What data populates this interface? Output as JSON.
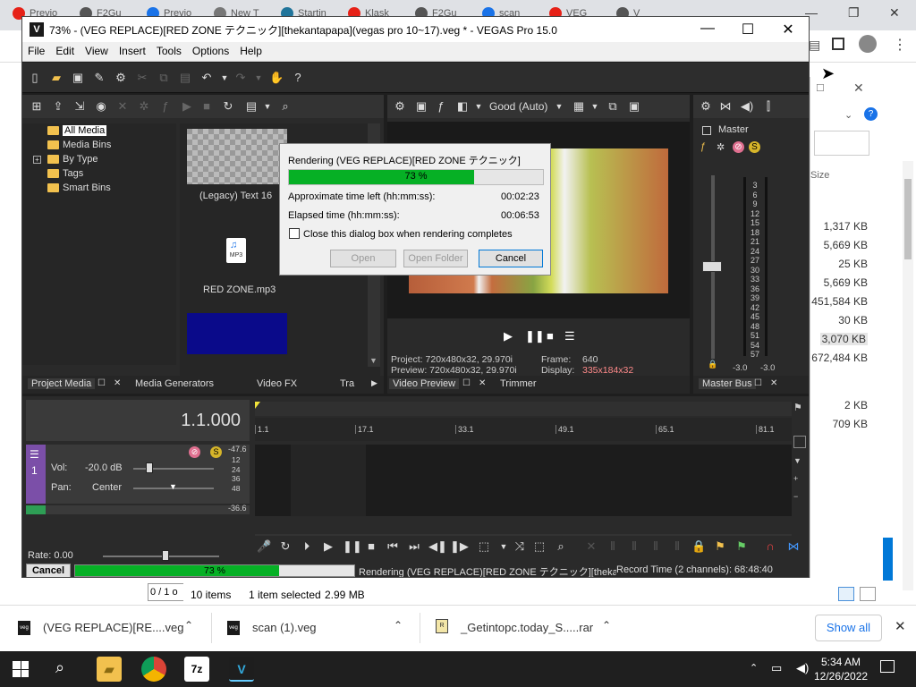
{
  "browser": {
    "tabs": [
      "Previo",
      "F2Gu",
      "Previo",
      "New T",
      "Startin",
      "Klask",
      "F2Gu",
      "scan",
      "VEG",
      "V"
    ],
    "tab_colors": [
      "#e62117",
      "#555555",
      "#1a73e8",
      "#777777",
      "#21759b",
      "#e62117",
      "#555555",
      "#1a73e8",
      "#e62117",
      "#555555"
    ]
  },
  "explorer": {
    "size_header": "Size",
    "sizes": [
      "1,317 KB",
      "5,669 KB",
      "25 KB",
      "5,669 KB",
      "451,584 KB",
      "30 KB",
      "3,070 KB",
      "672,484 KB",
      "2 KB",
      "709 KB"
    ],
    "status_count": "10 items",
    "status_selected": "1 item selected",
    "status_size": "2.99 MB",
    "page_partial": "0 / 1 o"
  },
  "vegas": {
    "title": "73% - (VEG REPLACE)[RED ZONE テクニック][thekantapapa](vegas pro 10~17).veg * - VEGAS Pro 15.0",
    "logo": "V",
    "menu": [
      "File",
      "Edit",
      "View",
      "Insert",
      "Tools",
      "Options",
      "Help"
    ],
    "media_tree": [
      "All Media",
      "Media Bins",
      "By Type",
      "Tags",
      "Smart Bins"
    ],
    "media_items": {
      "text_label": "(Legacy) Text 16",
      "mp3_label": "RED ZONE.mp3",
      "mp3_badge": "MP3"
    },
    "preview_quality": "Good (Auto)",
    "preview_info": {
      "project": "Project:  720x480x32, 29.970i",
      "preview": "Preview:  720x480x32, 29.970i",
      "frame_label": "Frame:",
      "frame_value": "640",
      "display_label": "Display:",
      "display_value": "335x184x32"
    },
    "master": {
      "title": "Master",
      "scale": [
        "3",
        "6",
        "9",
        "12",
        "15",
        "18",
        "21",
        "24",
        "27",
        "30",
        "33",
        "36",
        "39",
        "42",
        "45",
        "48",
        "51",
        "54",
        "57"
      ],
      "left_value": "-3.0",
      "right_value": "-3.0"
    },
    "panel_tabs": {
      "project_media": "Project Media",
      "media_generators": "Media Generators",
      "video_fx": "Video FX",
      "transitions": "Tra",
      "video_preview": "Video Preview",
      "trimmer": "Trimmer",
      "master_bus": "Master Bus"
    },
    "timecode": "1.1.000",
    "ruler": [
      "1.1",
      "17.1",
      "33.1",
      "49.1",
      "65.1",
      "81.1"
    ],
    "track": {
      "number": "1",
      "vol_label": "Vol:",
      "vol_value": "-20.0 dB",
      "pan_label": "Pan:",
      "pan_value": "Center",
      "level_top": "-47.6",
      "levels": [
        "12",
        "24",
        "36",
        "48"
      ],
      "level_bottom": "-36.6"
    },
    "rate": "Rate: 0.00",
    "status": {
      "cancel": "Cancel",
      "progress": 0.73,
      "progress_text": "73 %",
      "rendering_text": "Rendering (VEG REPLACE)[RED ZONE テクニック][thekantapa",
      "record_time": "Record Time (2 channels): 68:48:40"
    }
  },
  "dialog": {
    "title": "Rendering (VEG REPLACE)[RED ZONE テクニック]",
    "progress": 0.73,
    "progress_text": "73 %",
    "time_left_label": "Approximate time left (hh:mm:ss):",
    "time_left": "00:02:23",
    "elapsed_label": "Elapsed time (hh:mm:ss):",
    "elapsed": "00:06:53",
    "checkbox_label": "Close this dialog box when rendering completes",
    "buttons": [
      "Open",
      "Open Folder",
      "Cancel"
    ]
  },
  "downloads": {
    "items": [
      "(VEG REPLACE)[RE....veg",
      "scan (1).veg",
      "_Getintopc.today_S.....rar"
    ],
    "show_all": "Show all"
  },
  "taskbar": {
    "time": "5:34 AM",
    "date": "12/26/2022"
  }
}
